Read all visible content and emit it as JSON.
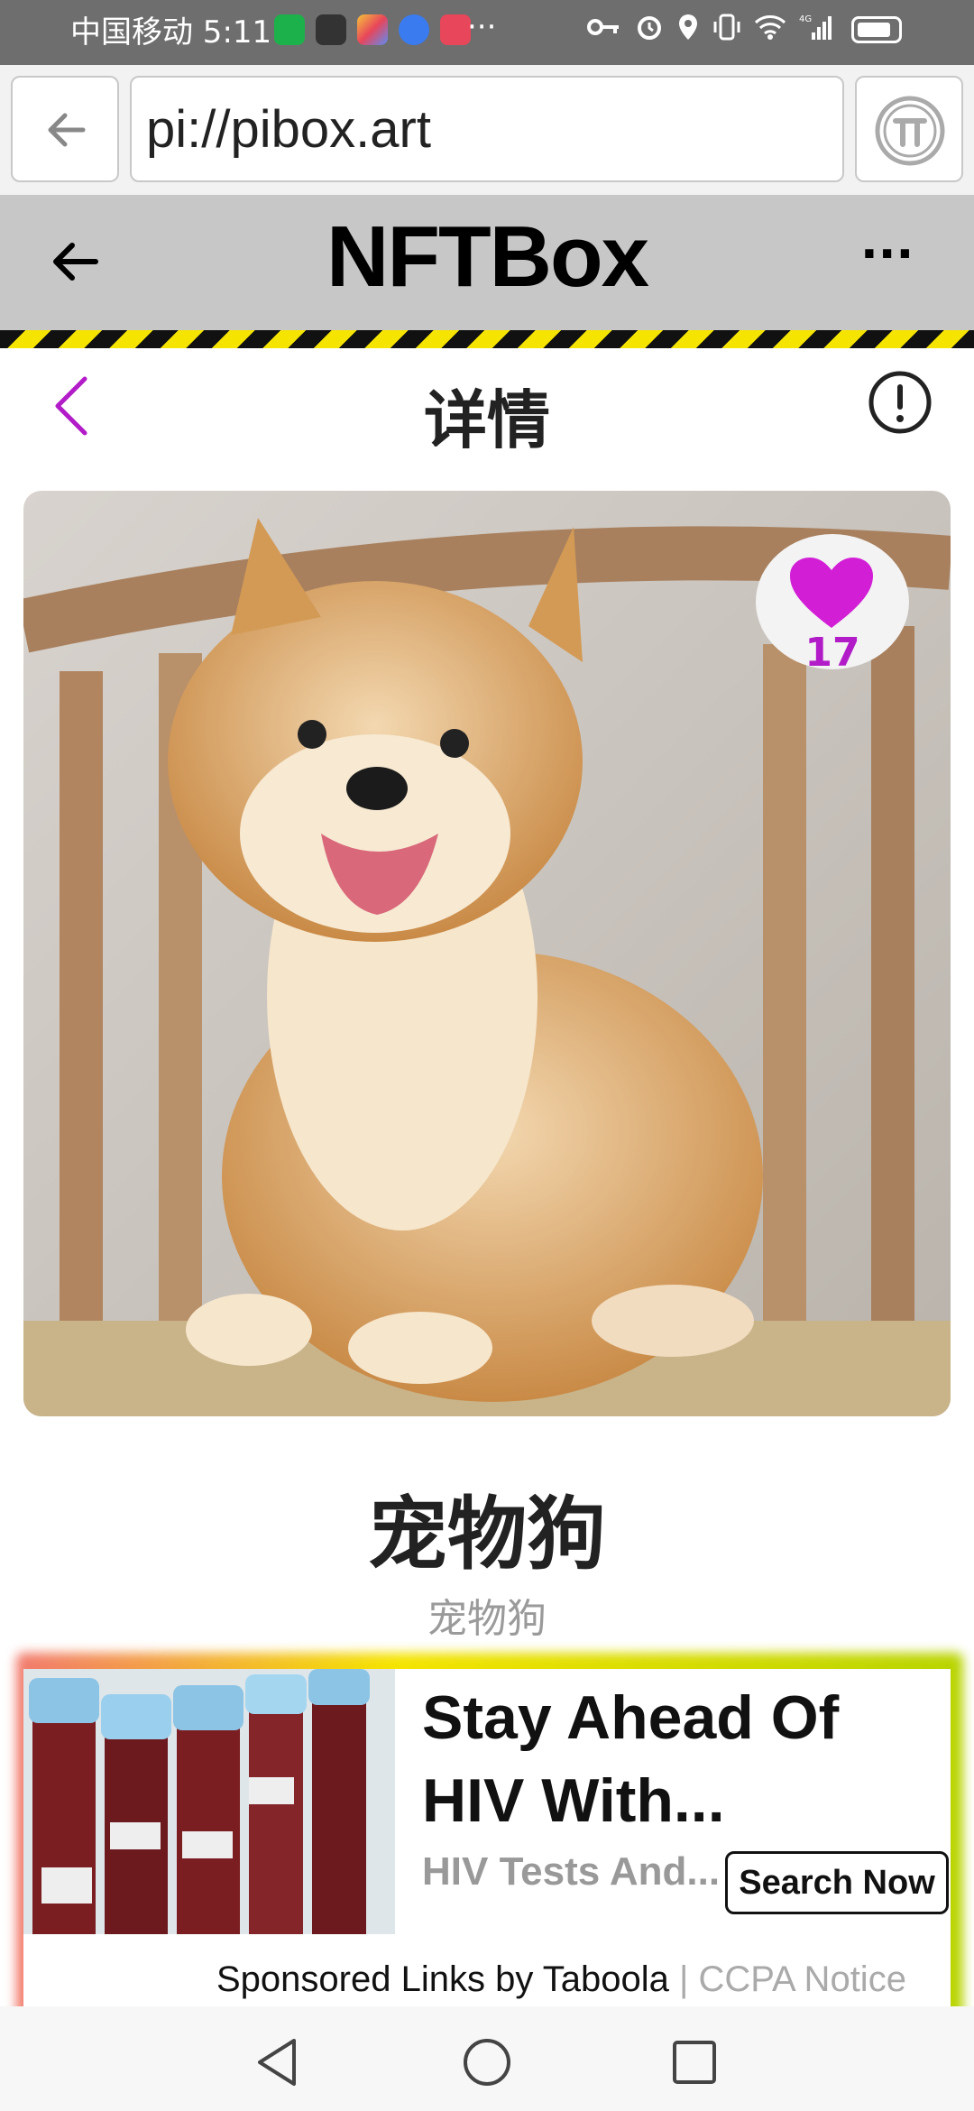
{
  "status_bar": {
    "carrier_time": "中国移动 5:11",
    "overflow": "···"
  },
  "browser": {
    "url": "pi://pibox.art"
  },
  "app_header": {
    "brand": "NFTBox",
    "menu": "···"
  },
  "page": {
    "title": "详情"
  },
  "nft": {
    "likes": "17",
    "name": "宠物狗",
    "subtitle": "宠物狗"
  },
  "ad": {
    "title": "Stay Ahead Of HIV With...",
    "subtitle": "HIV Tests And...",
    "cta": "Search Now",
    "sponsor": "Sponsored Links by Taboola",
    "separator": "|",
    "ccpa": "CCPA Notice"
  },
  "colors": {
    "accent": "#b21cc8",
    "header_bg": "#c7c7c7",
    "stripe_yellow": "#f5e400"
  },
  "icons": [
    "back-arrow-icon",
    "pi-logo-icon",
    "arrow-left-icon",
    "more-icon",
    "chevron-left-icon",
    "info-icon",
    "heart-icon",
    "nav-back-icon",
    "nav-home-icon",
    "nav-recents-icon"
  ]
}
